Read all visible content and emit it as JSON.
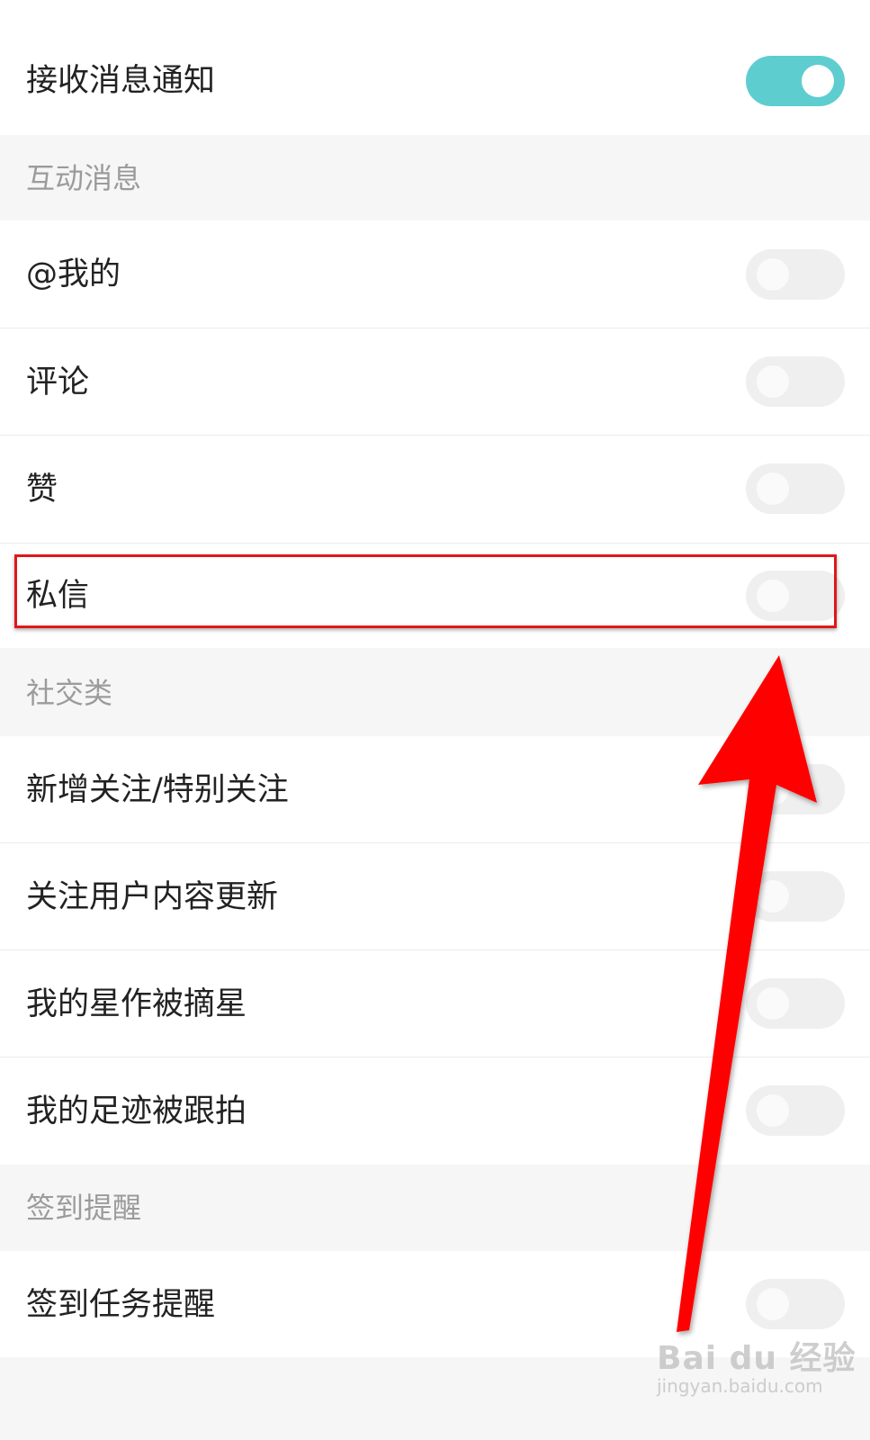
{
  "main_toggle": {
    "label": "接收消息通知",
    "on": true
  },
  "sections": [
    {
      "title": "互动消息",
      "items": [
        {
          "label": "@我的",
          "on": false
        },
        {
          "label": "评论",
          "on": false
        },
        {
          "label": "赞",
          "on": false
        },
        {
          "label": "私信",
          "on": false
        }
      ]
    },
    {
      "title": "社交类",
      "items": [
        {
          "label": "新增关注/特别关注",
          "on": false
        },
        {
          "label": "关注用户内容更新",
          "on": false
        },
        {
          "label": "我的星作被摘星",
          "on": false
        },
        {
          "label": "我的足迹被跟拍",
          "on": false
        }
      ]
    },
    {
      "title": "签到提醒",
      "items": [
        {
          "label": "签到任务提醒",
          "on": false
        }
      ]
    }
  ],
  "watermark": {
    "brand": "Bai du 经验",
    "domain": "jingyan.baidu.com"
  },
  "colors": {
    "toggle_on": "#5ecdd0",
    "toggle_off": "#efefef",
    "highlight": "#e01818",
    "arrow": "#ff0000"
  }
}
